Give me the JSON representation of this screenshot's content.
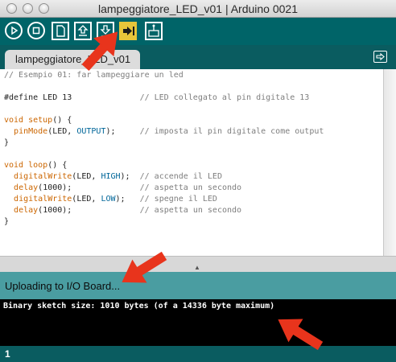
{
  "window": {
    "title": "lampeggiatore_LED_v01 | Arduino 0021"
  },
  "toolbar": {
    "buttons": [
      {
        "name": "verify",
        "icon": "play-icon"
      },
      {
        "name": "stop",
        "icon": "stop-icon"
      },
      {
        "name": "new",
        "icon": "new-file-icon"
      },
      {
        "name": "open",
        "icon": "open-upload-icon"
      },
      {
        "name": "save",
        "icon": "save-download-icon"
      },
      {
        "name": "upload",
        "icon": "upload-arrow-icon",
        "active": true
      },
      {
        "name": "serial-monitor",
        "icon": "serial-monitor-icon"
      }
    ],
    "bg_color": "#006468",
    "active_color": "#e8c53a"
  },
  "tabs": {
    "active_tab": "lampeggiatore_LED_v01"
  },
  "code": {
    "lines": [
      "// Esempio 01: far lampeggiare un led",
      "",
      "#define LED 13              // LED collegato al pin digitale 13",
      "",
      "void setup() {",
      "  pinMode(LED, OUTPUT);     // imposta il pin digitale come output",
      "}",
      "",
      "void loop() {",
      "  digitalWrite(LED, HIGH);  // accende il LED",
      "  delay(1000);              // aspetta un secondo",
      "  digitalWrite(LED, LOW);   // spegne il LED",
      "  delay(1000);              // aspetta un secondo",
      "}"
    ]
  },
  "status": {
    "message": "Uploading to I/O Board..."
  },
  "console": {
    "output": "Binary sketch size: 1010 bytes (of a 14336 byte maximum)"
  },
  "footer": {
    "line_number": "1"
  },
  "annotation_color": "#e8341c"
}
